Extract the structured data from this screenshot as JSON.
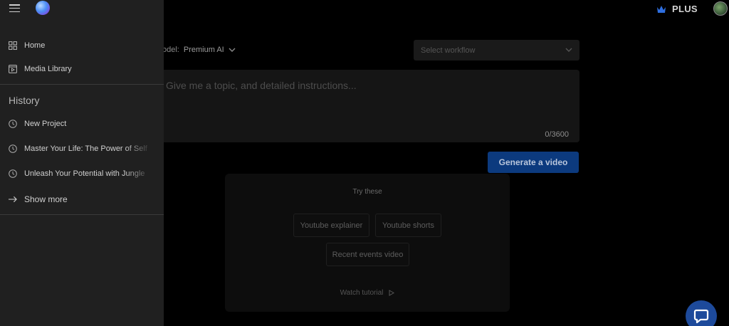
{
  "header": {
    "plan_label": "PLUS"
  },
  "sidebar": {
    "nav": [
      {
        "label": "Home",
        "icon": "grid-icon"
      },
      {
        "label": "Media Library",
        "icon": "media-library-icon"
      }
    ],
    "history_title": "History",
    "history": [
      {
        "label": "New Project",
        "icon": "clock-icon"
      },
      {
        "label": "Master Your Life: The Power of Self",
        "icon": "clock-icon"
      },
      {
        "label": "Unleash Your Potential with Jungle",
        "icon": "clock-icon"
      }
    ],
    "show_more": "Show more"
  },
  "main": {
    "model_prefix": "odel:",
    "model_value": "Premium AI",
    "workflow_placeholder": "Select workflow",
    "prompt_placeholder": "Give me a topic, and detailed instructions...",
    "char_count": "0/3600",
    "generate_label": "Generate a video",
    "try_title": "Try these",
    "suggestions": [
      "Youtube explainer",
      "Youtube shorts",
      "Recent events video"
    ],
    "watch_tutorial": "Watch tutorial"
  },
  "colors": {
    "accent": "#0c3a7e",
    "chat_button": "#1d4a9b",
    "crown": "#2f6fe0"
  }
}
